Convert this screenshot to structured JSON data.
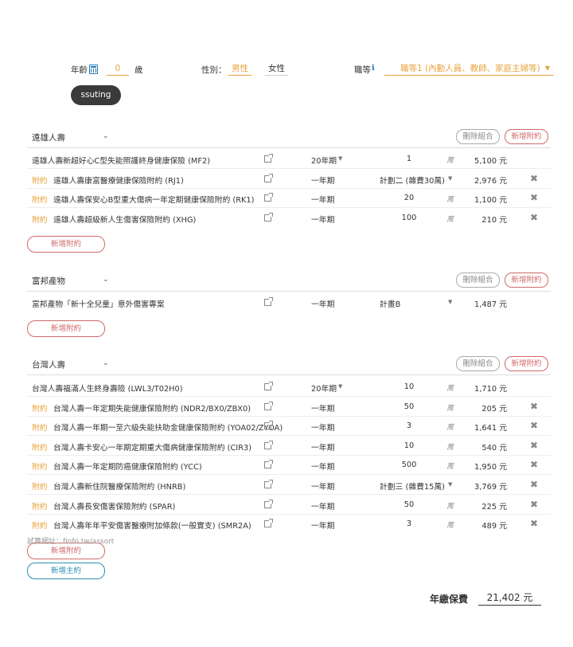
{
  "filters": {
    "age_label": "年齡",
    "age_value": "0",
    "age_unit": "歲",
    "gender_label": "性別：",
    "gender_male": "男性",
    "gender_female": "女性",
    "occupation_label": "職等",
    "occupation_value": "職等1 (內勤人員、教師、家庭主婦等)",
    "tag": "ssuting"
  },
  "buttons": {
    "delete_combo": "刪除組合",
    "add_rider": "新增附約",
    "add_main": "新增主約"
  },
  "rider_tag": "附約",
  "unit_wan": "萬",
  "companies": [
    {
      "name": "遠雄人壽",
      "rows": [
        {
          "rider": false,
          "name": "遠雄人壽新超好心C型失能照護終身健康保險 (MF2)",
          "term": "20年期",
          "amount": "1",
          "unit": true,
          "premium": "5,100 元",
          "remove": false
        },
        {
          "rider": true,
          "name": "遠雄人壽康富醫療健康保險附約 (RJ1)",
          "term": "一年期",
          "amount": "計劃二 (雜費30萬)",
          "select": true,
          "premium": "2,976 元",
          "remove": true
        },
        {
          "rider": true,
          "name": "遠雄人壽保安心B型重大傷病一年定期健康保險附約 (RK1)",
          "term": "一年期",
          "amount": "20",
          "unit": true,
          "premium": "1,100 元",
          "remove": true
        },
        {
          "rider": true,
          "name": "遠雄人壽超級新人生傷害保險附約 (XHG)",
          "term": "一年期",
          "amount": "100",
          "unit": true,
          "premium": "210 元",
          "remove": true
        }
      ]
    },
    {
      "name": "富邦產物",
      "rows": [
        {
          "rider": false,
          "name": "富邦產物「新十全兒童」意外傷害專案",
          "term": "一年期",
          "amount": "計畫B",
          "select": true,
          "premium": "1,487 元",
          "remove": false
        }
      ]
    },
    {
      "name": "台灣人壽",
      "rows": [
        {
          "rider": false,
          "name": "台灣人壽福滿人生終身壽險 (LWL3/T02H0)",
          "term": "20年期",
          "amount": "10",
          "unit": true,
          "premium": "1,710 元",
          "remove": false
        },
        {
          "rider": true,
          "name": "台灣人壽一年定期失能健康保險附約 (NDR2/BX0/ZBX0)",
          "term": "一年期",
          "amount": "50",
          "unit": true,
          "premium": "205 元",
          "remove": true
        },
        {
          "rider": true,
          "name": "台灣人壽一年期一至六級失能扶助金健康保險附約 (YOA02/ZYOA)",
          "term": "一年期",
          "amount": "3",
          "unit": true,
          "premium": "1,641 元",
          "remove": true
        },
        {
          "rider": true,
          "name": "台灣人壽卡安心一年期定期重大傷病健康保險附約 (CIR3)",
          "term": "一年期",
          "amount": "10",
          "unit": true,
          "premium": "540 元",
          "remove": true
        },
        {
          "rider": true,
          "name": "台灣人壽一年定期防癌健康保險附約 (YCC)",
          "term": "一年期",
          "amount": "500",
          "unit": true,
          "premium": "1,950 元",
          "remove": true
        },
        {
          "rider": true,
          "name": "台灣人壽新住院醫療保險附約 (HNRB)",
          "term": "一年期",
          "amount": "計劃三 (雜費15萬)",
          "select": true,
          "premium": "3,769 元",
          "remove": true
        },
        {
          "rider": true,
          "name": "台灣人壽長安傷害保險附約 (SPAR)",
          "term": "一年期",
          "amount": "50",
          "unit": true,
          "premium": "225 元",
          "remove": true
        },
        {
          "rider": true,
          "name": "台灣人壽年年平安傷害醫療附加條款(一般實支) (SMR2A)",
          "term": "一年期",
          "amount": "3",
          "unit": true,
          "premium": "489 元",
          "remove": true
        }
      ]
    }
  ],
  "watermark": "試算網址：finfo.tw/assort",
  "total": {
    "label": "年繳保費",
    "value": "21,402 元"
  }
}
